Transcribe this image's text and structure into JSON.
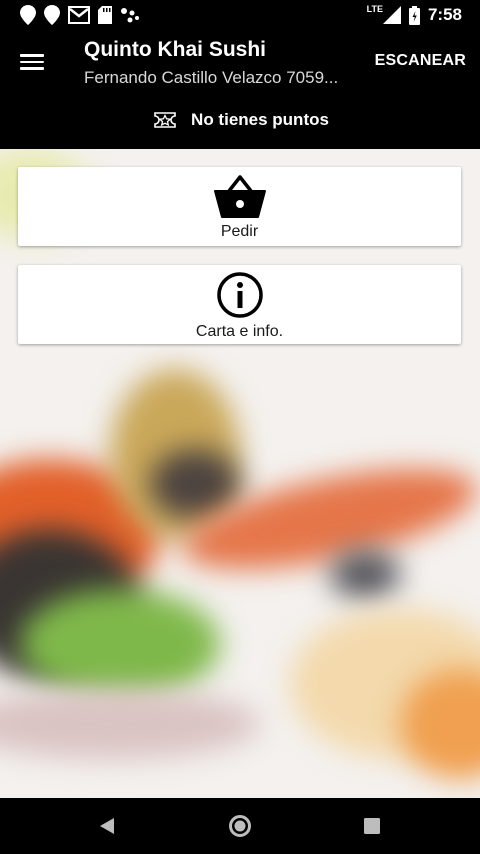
{
  "status_bar": {
    "time": "7:58",
    "network": "LTE",
    "icons_left": [
      "location-icon",
      "location-icon",
      "gmail-icon",
      "sd-card-icon",
      "assistant-dots-icon"
    ],
    "icons_right": [
      "signal-icon",
      "battery-icon"
    ]
  },
  "app_bar": {
    "title": "Quinto Khai Sushi",
    "subtitle": "Fernando Castillo Velazco 7059...",
    "scan_label": "ESCANEAR",
    "points_text": "No tienes puntos",
    "menu_icon": "hamburger-menu-icon",
    "points_icon": "star-badge-icon"
  },
  "actions": [
    {
      "label": "Pedir",
      "icon": "basket-icon"
    },
    {
      "label": "Carta e info.",
      "icon": "info-icon"
    }
  ],
  "nav_bar": {
    "buttons": [
      "back-icon",
      "home-icon",
      "recents-icon"
    ]
  },
  "colors": {
    "bar_background": "#000000",
    "bar_text": "#ffffff",
    "card_background": "#ffffff"
  }
}
